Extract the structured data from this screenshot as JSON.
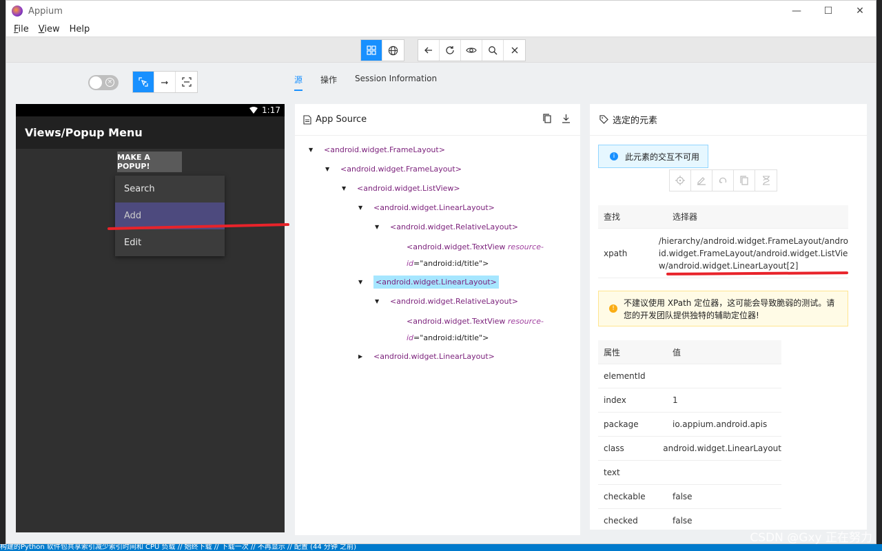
{
  "window": {
    "title": "Appium"
  },
  "menu": [
    {
      "label": "File",
      "mnemonic": "F",
      "rest": "ile"
    },
    {
      "label": "View",
      "mnemonic": "V",
      "rest": "iew"
    },
    {
      "label": "Help",
      "mnemonic": "",
      "rest": "Help"
    }
  ],
  "device": {
    "time": "1:17",
    "app_title": "Views/Popup Menu",
    "popup_button": "MAKE A POPUP!",
    "menu_items": [
      "Search",
      "Add",
      "Edit"
    ]
  },
  "tabs": [
    "源",
    "操作",
    "Session Information"
  ],
  "source": {
    "title": "App Source",
    "nodes": [
      {
        "text": "<android.widget.FrameLayout>"
      },
      {
        "text": "<android.widget.FrameLayout>"
      },
      {
        "text": "<android.widget.ListView>"
      },
      {
        "text": "<android.widget.LinearLayout>"
      },
      {
        "text": "<android.widget.RelativeLayout>"
      },
      {
        "tag": "<android.widget.TextView ",
        "attr1": "resource-",
        "attr2": "id",
        "val": "=\"android:id/title\">"
      },
      {
        "text": "<android.widget.LinearLayout>",
        "selected": true
      },
      {
        "text": "<android.widget.RelativeLayout>"
      },
      {
        "tag": "<android.widget.TextView ",
        "attr1": "resource-",
        "attr2": "id",
        "val": "=\"android:id/title\">"
      },
      {
        "text": "<android.widget.LinearLayout>"
      }
    ]
  },
  "selected": {
    "title": "选定的元素",
    "info": "此元素的交互不可用",
    "find_headers": [
      "查找",
      "选择器"
    ],
    "find_strategy": "xpath",
    "xpath_lines": [
      "/hierarchy/android.widget.FrameLayout/andro",
      "id.widget.FrameLayout/android.widget.ListVie",
      "w/android.widget.LinearLayout[2]"
    ],
    "warning_lines": [
      "不建议使用 XPath 定位器，这可能会导致脆弱的测试。请",
      "您的开发团队提供独特的辅助定位器!"
    ],
    "attr_headers": [
      "属性",
      "值"
    ],
    "attributes": [
      {
        "name": "elementId",
        "value": ""
      },
      {
        "name": "index",
        "value": "1"
      },
      {
        "name": "package",
        "value": "io.appium.android.apis"
      },
      {
        "name": "class",
        "value": "android.widget.LinearLayout"
      },
      {
        "name": "text",
        "value": ""
      },
      {
        "name": "checkable",
        "value": "false"
      },
      {
        "name": "checked",
        "value": "false"
      }
    ]
  },
  "watermark": "CSDN @Gxy 正在努力",
  "taskbar_text": "构建的Python 软件包共享索引减少索引时间和 CPU 负载 // 始终下载 // 下载一次 // 不再显示 // 配置 (44 分钟 之前)",
  "colors": {
    "accent": "#1890ff",
    "selected_node": "#a6e6ff",
    "annotation": "#e8232a"
  }
}
